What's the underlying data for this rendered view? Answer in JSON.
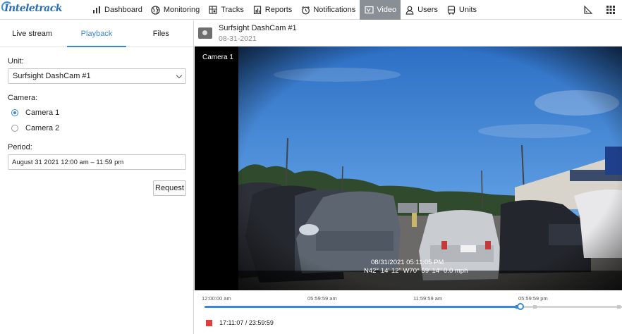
{
  "brand": {
    "name": "Inteletrack"
  },
  "nav": {
    "items": [
      {
        "label": "Dashboard",
        "icon": "bar-chart-icon"
      },
      {
        "label": "Monitoring",
        "icon": "globe-icon"
      },
      {
        "label": "Tracks",
        "icon": "map-grid-icon"
      },
      {
        "label": "Reports",
        "icon": "report-icon"
      },
      {
        "label": "Notifications",
        "icon": "alarm-clock-icon"
      },
      {
        "label": "Video",
        "icon": "video-icon",
        "active": true
      },
      {
        "label": "Users",
        "icon": "user-icon"
      },
      {
        "label": "Units",
        "icon": "bus-icon"
      }
    ],
    "right_icons": [
      "ruler-icon",
      "apps-grid-icon"
    ],
    "active_color": "#8a8f96"
  },
  "left": {
    "tabs": [
      {
        "label": "Live stream"
      },
      {
        "label": "Playback",
        "active": true
      },
      {
        "label": "Files"
      }
    ],
    "unit_label": "Unit:",
    "unit_value": "Surfsight DashCam #1",
    "camera_label": "Camera:",
    "cameras": [
      {
        "label": "Camera 1",
        "selected": true
      },
      {
        "label": "Camera 2",
        "selected": false
      }
    ],
    "period_label": "Period:",
    "period_value": "August 31 2021 12:00 am – 11:59 pm",
    "request_label": "Request"
  },
  "player": {
    "device_name": "Surfsight DashCam #1",
    "device_date": "08-31-2021",
    "camera_label": "Camera 1",
    "overlay_datetime": "08/31/2021 05:11:05 PM",
    "overlay_location": "N42° 14' 12\" W70° 59' 14\" 0.0 mph",
    "ticks": [
      "12:00:00 am",
      "05:59:59 am",
      "11:59:59 am",
      "05:59:59 pm"
    ],
    "played_fraction": 0.7,
    "time_display": "17:11:07 / 23:59:59"
  },
  "colors": {
    "accent": "#3a86d8",
    "record": "#e23c3c"
  }
}
